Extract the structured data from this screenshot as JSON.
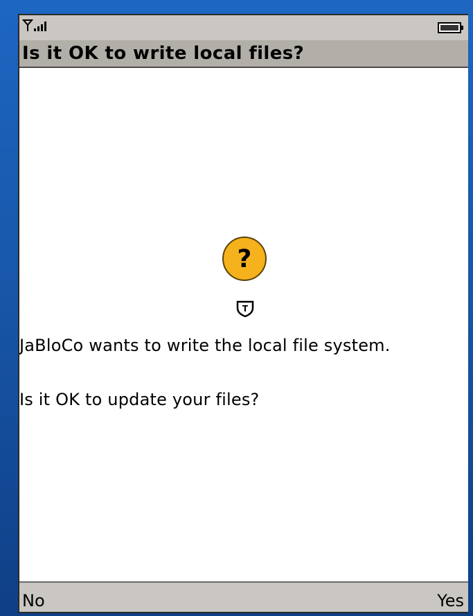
{
  "status_bar": {
    "signal_icon": "signal-strength-icon",
    "battery_icon": "battery-icon"
  },
  "dialog": {
    "title": "Is it OK to write local files?",
    "icon": "question-icon",
    "trust_icon": "trusted-shield-icon",
    "message_line1": "JaBloCo wants to write the local file system.",
    "message_line2": "Is it OK to update your files?"
  },
  "softkeys": {
    "left_label": "No",
    "right_label": "Yes"
  },
  "colors": {
    "background": "#1a5cb0",
    "status_bar": "#cac6c2",
    "title_bar": "#b2aea8",
    "question_icon_fill": "#f5b21c"
  }
}
